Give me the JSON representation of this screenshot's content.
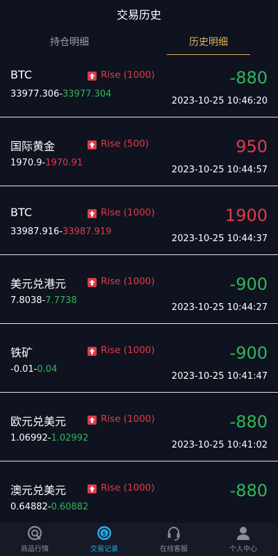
{
  "header": {
    "title": "交易历史"
  },
  "tabs": [
    {
      "label": "持仓明细",
      "active": false
    },
    {
      "label": "历史明细",
      "active": true
    }
  ],
  "colors": {
    "profit": "#30b858",
    "loss": "#e03b4a",
    "accent": "#e3b05c",
    "nav_active": "#2aa6e0"
  },
  "records": [
    {
      "name": "BTC",
      "direction": "Rise (1000)",
      "open_price": "33977.306",
      "close_price": "33977.304",
      "close_color": "green",
      "pl": "-880",
      "pl_color": "green",
      "time": "2023-10-25 10:46:20"
    },
    {
      "name": "国际黄金",
      "direction": "Rise (500)",
      "open_price": "1970.9",
      "close_price": "1970.91",
      "close_color": "red",
      "pl": "950",
      "pl_color": "red",
      "time": "2023-10-25 10:44:57"
    },
    {
      "name": "BTC",
      "direction": "Rise (1000)",
      "open_price": "33987.916",
      "close_price": "33987.919",
      "close_color": "red",
      "pl": "1900",
      "pl_color": "red",
      "time": "2023-10-25 10:44:37"
    },
    {
      "name": "美元兑港元",
      "direction": "Rise (1000)",
      "open_price": "7.8038",
      "close_price": "7.7738",
      "close_color": "green",
      "pl": "-900",
      "pl_color": "green",
      "time": "2023-10-25 10:44:27"
    },
    {
      "name": "铁矿",
      "direction": "Rise (1000)",
      "open_price": "-0.01",
      "close_price": "0.04",
      "close_color": "green",
      "pl": "-900",
      "pl_color": "green",
      "time": "2023-10-25 10:41:47"
    },
    {
      "name": "欧元兑美元",
      "direction": "Rise (1000)",
      "open_price": "1.06992",
      "close_price": "1.02992",
      "close_color": "green",
      "pl": "-880",
      "pl_color": "green",
      "time": "2023-10-25 10:41:02"
    },
    {
      "name": "澳元兑美元",
      "direction": "Rise (1000)",
      "open_price": "0.64882",
      "close_price": "0.60882",
      "close_color": "green",
      "pl": "-880",
      "pl_color": "green",
      "time": ""
    }
  ],
  "tabbar": [
    {
      "label": "商品行情",
      "icon": "market-icon",
      "active": false
    },
    {
      "label": "交易记录",
      "icon": "trade-record-icon",
      "active": true
    },
    {
      "label": "在线客服",
      "icon": "headset-icon",
      "active": false
    },
    {
      "label": "个人中心",
      "icon": "user-icon",
      "active": false
    }
  ]
}
